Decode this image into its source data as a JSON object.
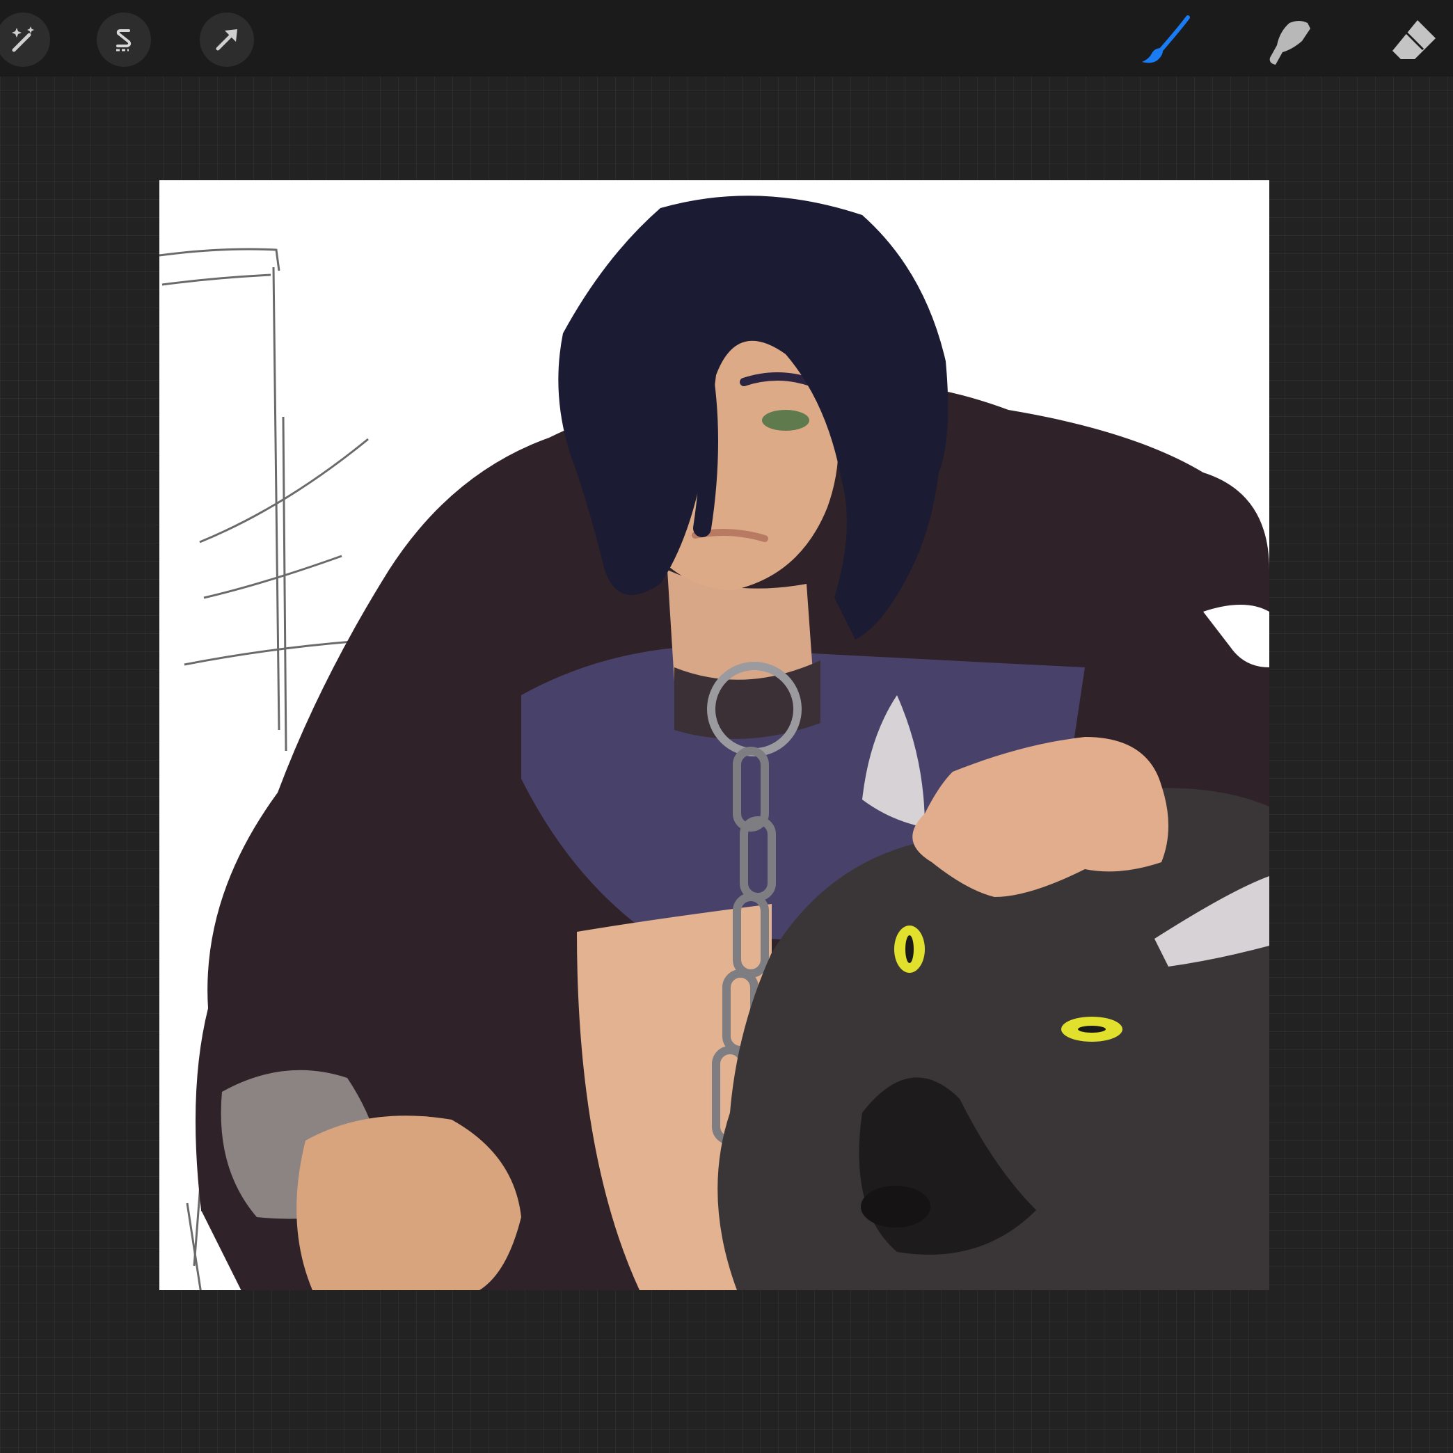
{
  "app": {
    "accent_color": "#1a7cf5",
    "toolbar_bg": "#1b1b1c",
    "workspace_bg": "#222223"
  },
  "toolbar": {
    "left_tools": [
      {
        "icon": "magic-wand-icon",
        "name": "adjustments"
      },
      {
        "icon": "selection-s-icon",
        "name": "selection"
      },
      {
        "icon": "arrow-cursor-icon",
        "name": "transform"
      }
    ],
    "right_tools": [
      {
        "icon": "brush-icon",
        "name": "paint",
        "active": true
      },
      {
        "icon": "smudge-finger-icon",
        "name": "smudge",
        "active": false
      },
      {
        "icon": "eraser-icon",
        "name": "erase",
        "active": false
      }
    ]
  },
  "canvas": {
    "background": "#ffffff",
    "artwork": "digital-painting"
  }
}
